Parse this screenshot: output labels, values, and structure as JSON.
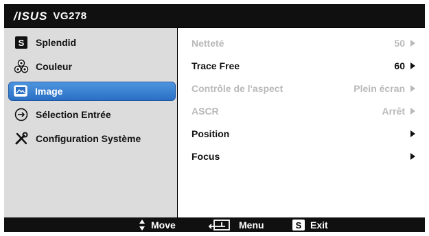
{
  "header": {
    "brand": "/ISUS",
    "model": "VG278"
  },
  "sidebar": {
    "items": [
      {
        "label": "Splendid",
        "icon": "splendid-s-icon"
      },
      {
        "label": "Couleur",
        "icon": "color-dots-icon"
      },
      {
        "label": "Image",
        "icon": "image-icon",
        "selected": true
      },
      {
        "label": "Sélection Entrée",
        "icon": "input-select-icon"
      },
      {
        "label": "Configuration Système",
        "icon": "tools-icon"
      }
    ]
  },
  "settings": {
    "rows": [
      {
        "label": "Netteté",
        "value": "50",
        "enabled": false
      },
      {
        "label": "Trace Free",
        "value": "60",
        "enabled": true
      },
      {
        "label": "Contrôle de l'aspect",
        "value": "Plein écran",
        "enabled": false
      },
      {
        "label": "ASCR",
        "value": "Arrêt",
        "enabled": false
      },
      {
        "label": "Position",
        "value": "",
        "enabled": true
      },
      {
        "label": "Focus",
        "value": "",
        "enabled": true
      }
    ]
  },
  "footer": {
    "move": "Move",
    "menu": "Menu",
    "exit": "Exit",
    "exit_key": "S"
  },
  "sidebar_icon_letter": "S",
  "colors": {
    "selected_bg": "#3a7fd0",
    "disabled_text": "#b9b9b9",
    "panel_bg": "#dcdcdc",
    "bar_bg": "#101010"
  }
}
